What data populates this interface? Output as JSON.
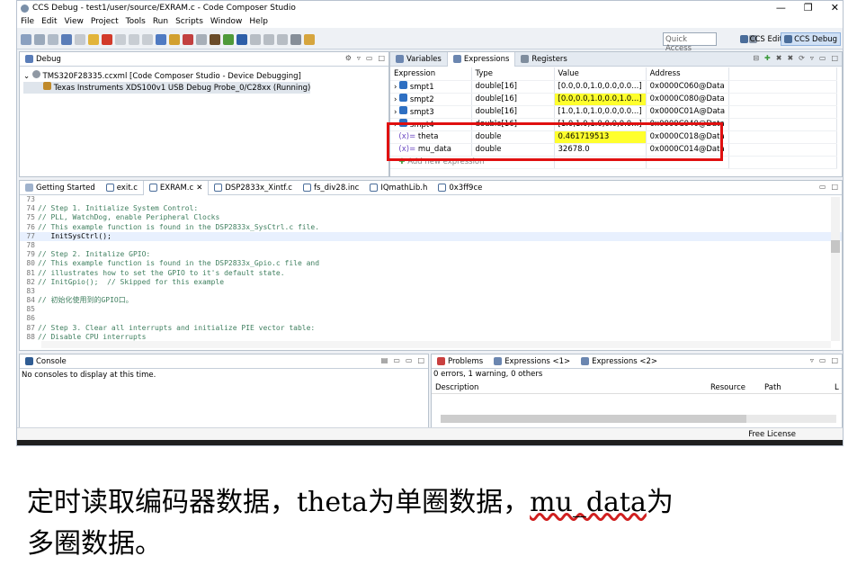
{
  "window": {
    "title": "CCS Debug - test1/user/source/EXRAM.c - Code Composer Studio",
    "controls": [
      "—",
      "❐",
      "✕"
    ]
  },
  "menu": [
    "File",
    "Edit",
    "View",
    "Project",
    "Tools",
    "Run",
    "Scripts",
    "Window",
    "Help"
  ],
  "toolbar": {
    "quick_access": "Quick Access",
    "persp_edit": "CCS Edit",
    "persp_debug": "CCS Debug"
  },
  "debug": {
    "tab": "Debug",
    "target": "TMS320F28335.ccxml [Code Composer Studio - Device Debugging]",
    "probe": "Texas Instruments XDS100v1 USB Debug Probe_0/C28xx (Running)"
  },
  "expr_tabs": [
    "Variables",
    "Expressions",
    "Registers"
  ],
  "expr_headers": [
    "Expression",
    "Type",
    "Value",
    "Address"
  ],
  "expr_rows": [
    {
      "name": "smpt1",
      "type": "double[16]",
      "value": "[0.0,0.0,1.0,0.0,0.0...]",
      "addr": "0x0000C060@Data",
      "hl": false
    },
    {
      "name": "smpt2",
      "type": "double[16]",
      "value": "[0.0,0.0,1.0,0.0,1.0...]",
      "addr": "0x0000C080@Data",
      "hl": true
    },
    {
      "name": "smpt3",
      "type": "double[16]",
      "value": "[1.0,1.0,1.0,0.0,0.0...]",
      "addr": "0x0000C01A@Data",
      "hl": false
    },
    {
      "name": "smpt4",
      "type": "double[16]",
      "value": "[1.0,1.0,1.0,0.0,0.0...]",
      "addr": "0x0000C040@Data",
      "hl": false
    },
    {
      "name": "theta",
      "type": "double",
      "value": "0.461719513",
      "addr": "0x0000C018@Data",
      "hl": true
    },
    {
      "name": "mu_data",
      "type": "double",
      "value": "32678.0",
      "addr": "0x0000C014@Data",
      "hl": false
    }
  ],
  "expr_add": "Add new expression",
  "editor_tabs": [
    "Getting Started",
    "exit.c",
    "EXRAM.c",
    "DSP2833x_Xintf.c",
    "fs_div28.inc",
    "IQmathLib.h",
    "0x3ff9ce"
  ],
  "code": [
    {
      "n": "73",
      "t": "",
      "c": false
    },
    {
      "n": "74",
      "t": "// Step 1. Initialize System Control:",
      "c": true
    },
    {
      "n": "75",
      "t": "// PLL, WatchDog, enable Peripheral Clocks",
      "c": true
    },
    {
      "n": "76",
      "t": "// This example function is found in the DSP2833x_SysCtrl.c file.",
      "c": true
    },
    {
      "n": "77",
      "t": "   InitSysCtrl();",
      "c": false
    },
    {
      "n": "78",
      "t": "",
      "c": false
    },
    {
      "n": "79",
      "t": "// Step 2. Initalize GPIO:",
      "c": true
    },
    {
      "n": "80",
      "t": "// This example function is found in the DSP2833x_Gpio.c file and",
      "c": true
    },
    {
      "n": "81",
      "t": "// illustrates how to set the GPIO to it's default state.",
      "c": true
    },
    {
      "n": "82",
      "t": "// InitGpio();  // Skipped for this example",
      "c": true
    },
    {
      "n": "83",
      "t": "",
      "c": false
    },
    {
      "n": "84",
      "t": "// 初始化使用到的GPIO口。",
      "c": true
    },
    {
      "n": "85",
      "t": "",
      "c": false
    },
    {
      "n": "86",
      "t": "",
      "c": false
    },
    {
      "n": "87",
      "t": "// Step 3. Clear all interrupts and initialize PIE vector table:",
      "c": true
    },
    {
      "n": "88",
      "t": "// Disable CPU interrupts",
      "c": true
    }
  ],
  "console": {
    "tab": "Console",
    "msg": "No consoles to display at this time."
  },
  "problems": {
    "tabs": [
      "Problems",
      "Expressions <1>",
      "Expressions <2>"
    ],
    "summary": "0 errors, 1 warning, 0 others",
    "headers": [
      "Description",
      "Resource",
      "Path",
      "L"
    ]
  },
  "status": {
    "license": "Free License"
  },
  "caption": {
    "line1a": "定时读取编码器数据，theta为单圈数据，",
    "line1b": "mu_data",
    "line1c": "为",
    "line2": "多圈数据。"
  }
}
